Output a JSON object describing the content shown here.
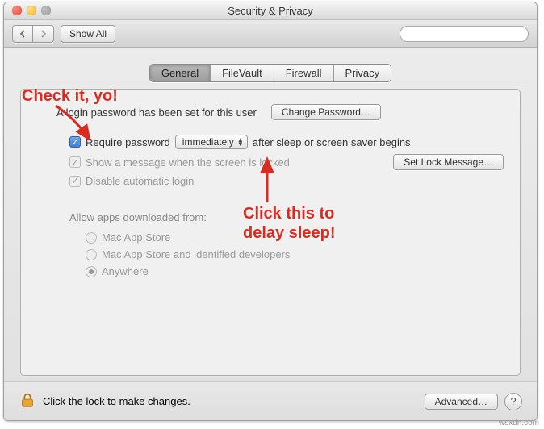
{
  "window": {
    "title": "Security & Privacy"
  },
  "toolbar": {
    "show_all": "Show All",
    "search_placeholder": ""
  },
  "tabs": {
    "general": "General",
    "filevault": "FileVault",
    "firewall": "Firewall",
    "privacy": "Privacy"
  },
  "panel": {
    "password_set": "A login password has been set for this user",
    "change_password": "Change Password…",
    "require_password": "Require password",
    "delay": "immediately",
    "after_sleep": "after sleep or screen saver begins",
    "show_message": "Show a message when the screen is locked",
    "set_lock_message": "Set Lock Message…",
    "disable_auto_login": "Disable automatic login",
    "allow_apps_label": "Allow apps downloaded from:",
    "apps_opt1": "Mac App Store",
    "apps_opt2": "Mac App Store and identified developers",
    "apps_opt3": "Anywhere"
  },
  "footer": {
    "lock_text": "Click the lock to make changes.",
    "advanced": "Advanced…",
    "help": "?"
  },
  "annotation": {
    "check_it": "Check it, yo!",
    "click_delay_1": "Click this to",
    "click_delay_2": "delay sleep!"
  },
  "watermark": "wsxdn.com"
}
